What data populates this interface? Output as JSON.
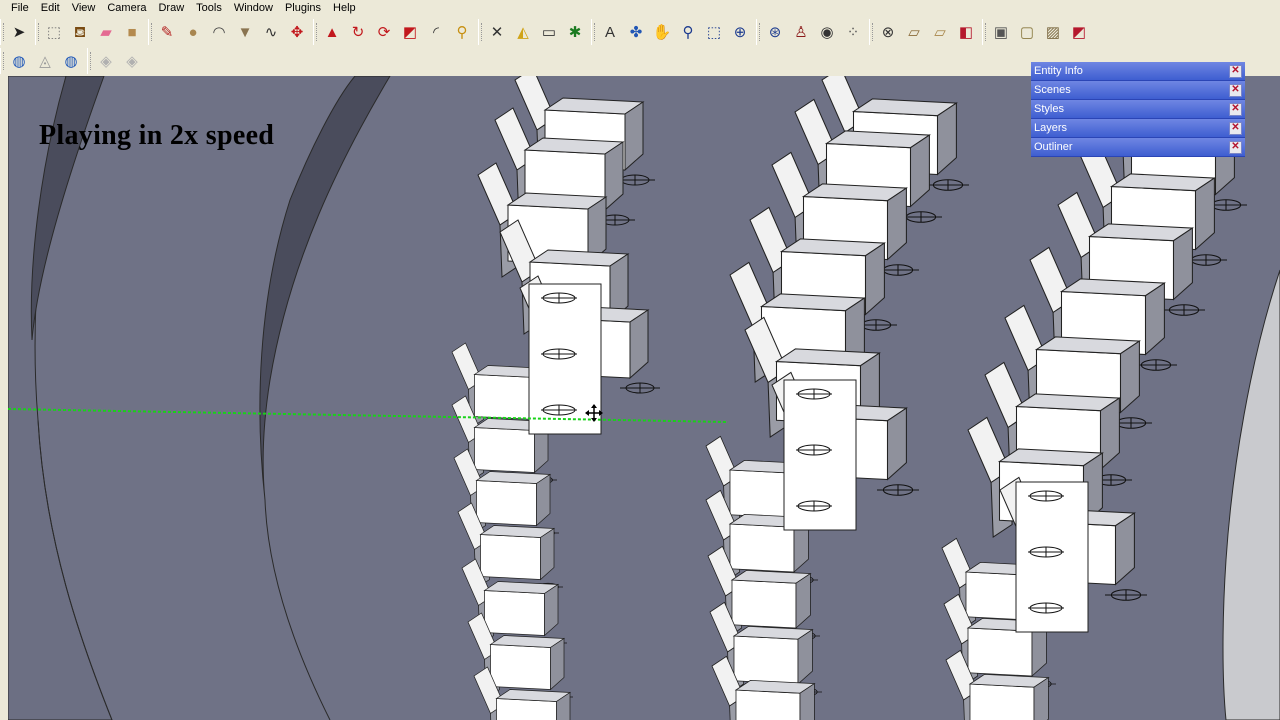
{
  "menu": [
    "File",
    "Edit",
    "View",
    "Camera",
    "Draw",
    "Tools",
    "Window",
    "Plugins",
    "Help"
  ],
  "toolbar1": [
    {
      "icon": "select-arrow-icon",
      "glyph": "➤",
      "color": "#222"
    },
    {
      "icon": "make-component-icon",
      "glyph": "⬚",
      "color": "#777"
    },
    {
      "icon": "paint-bucket-icon",
      "glyph": "⛾",
      "color": "#7a4b12"
    },
    {
      "icon": "eraser-icon",
      "glyph": "▰",
      "color": "#e46a92"
    },
    {
      "icon": "rectangle-icon",
      "glyph": "■",
      "color": "#b48a4e"
    },
    {
      "icon": "line-pencil-icon",
      "glyph": "✎",
      "color": "#b32020"
    },
    {
      "icon": "circle-icon",
      "glyph": "●",
      "color": "#a88650"
    },
    {
      "icon": "arc-icon",
      "glyph": "◠",
      "color": "#444"
    },
    {
      "icon": "polygon-icon",
      "glyph": "▼",
      "color": "#8a7450"
    },
    {
      "icon": "freehand-icon",
      "glyph": "∿",
      "color": "#333"
    },
    {
      "icon": "move-icon",
      "glyph": "✥",
      "color": "#c2181d"
    },
    {
      "icon": "push-pull-icon",
      "glyph": "▲",
      "color": "#c2181d"
    },
    {
      "icon": "rotate-icon",
      "glyph": "↻",
      "color": "#c2181d"
    },
    {
      "icon": "follow-me-icon",
      "glyph": "⟳",
      "color": "#c2181d"
    },
    {
      "icon": "scale-icon",
      "glyph": "◩",
      "color": "#c2181d"
    },
    {
      "icon": "offset-icon",
      "glyph": "◜",
      "color": "#333"
    },
    {
      "icon": "tape-measure-icon",
      "glyph": "⚲",
      "color": "#c79012"
    },
    {
      "icon": "dimension-icon",
      "glyph": "✕",
      "color": "#333"
    },
    {
      "icon": "protractor-icon",
      "glyph": "◭",
      "color": "#d0a418"
    },
    {
      "icon": "text-icon",
      "glyph": "▭",
      "color": "#333"
    },
    {
      "icon": "axes-icon",
      "glyph": "✱",
      "color": "#1b7a20"
    },
    {
      "icon": "3d-text-icon",
      "glyph": "A",
      "color": "#333"
    },
    {
      "icon": "orbit-icon",
      "glyph": "✤",
      "color": "#2156b5"
    },
    {
      "icon": "pan-hand-icon",
      "glyph": "✋",
      "color": "#555"
    },
    {
      "icon": "zoom-icon",
      "glyph": "⚲",
      "color": "#1c3b8f"
    },
    {
      "icon": "zoom-window-icon",
      "glyph": "⬚",
      "color": "#1c3b8f"
    },
    {
      "icon": "zoom-extents-icon",
      "glyph": "⊕",
      "color": "#1c3b8f"
    },
    {
      "icon": "previous-view-icon",
      "glyph": "⊛",
      "color": "#1c3b8f"
    },
    {
      "icon": "position-camera-icon",
      "glyph": "♙",
      "color": "#8b1a1a"
    },
    {
      "icon": "look-around-icon",
      "glyph": "◉",
      "color": "#333"
    },
    {
      "icon": "walk-icon",
      "glyph": "⁘",
      "color": "#555"
    },
    {
      "icon": "section-plane-icon",
      "glyph": "⊗",
      "color": "#333"
    },
    {
      "icon": "get-models-icon",
      "glyph": "▱",
      "color": "#8a6b3a"
    },
    {
      "icon": "share-model-icon",
      "glyph": "▱",
      "color": "#a8864a"
    },
    {
      "icon": "share-component-icon",
      "glyph": "◧",
      "color": "#b5182d"
    },
    {
      "icon": "photo-textures-icon",
      "glyph": "▣",
      "color": "#555"
    },
    {
      "icon": "add-location-icon",
      "glyph": "▢",
      "color": "#8a7a40"
    },
    {
      "icon": "toggle-terrain-icon",
      "glyph": "▨",
      "color": "#7a6840"
    },
    {
      "icon": "preview-google-earth-icon",
      "glyph": "◩",
      "color": "#b5182d"
    }
  ],
  "toolbar2": [
    {
      "icon": "globe-icon",
      "glyph": "◍",
      "color": "#1d56b8"
    },
    {
      "icon": "photo-match-icon",
      "glyph": "◬",
      "color": "#9a9a9a"
    },
    {
      "icon": "globe-upload-icon",
      "glyph": "◍",
      "color": "#1d56b8"
    },
    {
      "icon": "sandbox-icon",
      "glyph": "◈",
      "color": "#b0b0b0"
    },
    {
      "icon": "sandbox-stamp-icon",
      "glyph": "◈",
      "color": "#b0b0b0"
    }
  ],
  "overlay_text": "Playing in 2x speed",
  "tray": [
    "Entity Info",
    "Scenes",
    "Styles",
    "Layers",
    "Outliner"
  ],
  "colors": {
    "viewport": "#6f7286",
    "tray": "#4865d8",
    "seat": "#ffffff",
    "axis": "#19d219"
  }
}
